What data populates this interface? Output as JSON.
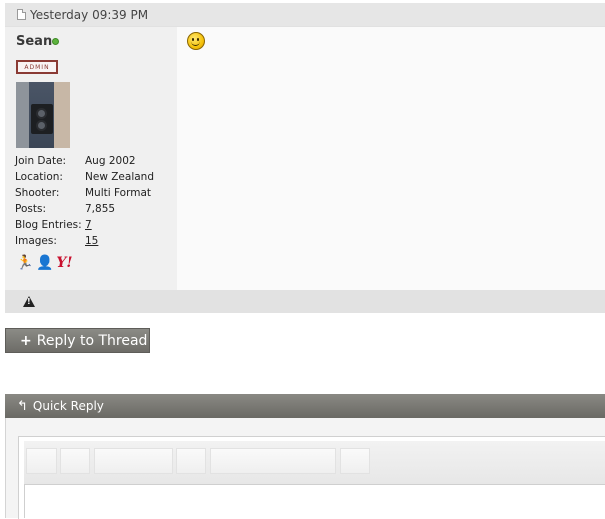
{
  "post": {
    "timestamp": "Yesterday 09:39 PM"
  },
  "user": {
    "name": "Sean",
    "status": "online",
    "badge": "ADMIN",
    "details": [
      {
        "label": "Join Date:",
        "value": "Aug 2002",
        "link": false
      },
      {
        "label": "Location:",
        "value": "New Zealand",
        "link": false
      },
      {
        "label": "Shooter:",
        "value": "Multi Format",
        "link": false
      },
      {
        "label": "Posts:",
        "value": "7,855",
        "link": false
      },
      {
        "label": "Blog Entries:",
        "value": "7",
        "link": true
      },
      {
        "label": "Images:",
        "value": "15",
        "link": true
      }
    ],
    "im_icons": [
      "aim-icon",
      "msn-icon",
      "yahoo-icon"
    ]
  },
  "buttons": {
    "reply_to_thread": "Reply to Thread"
  },
  "quick_reply": {
    "title": "Quick Reply"
  },
  "colors": {
    "header_bg": "#e6e6e6",
    "button_bg": "#7b7a75",
    "online": "#5db33e",
    "admin": "#8a3a34"
  }
}
